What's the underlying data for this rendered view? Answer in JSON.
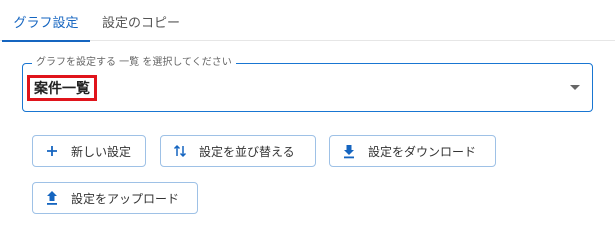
{
  "tabs": [
    {
      "label": "グラフ設定",
      "active": true
    },
    {
      "label": "設定のコピー",
      "active": false
    }
  ],
  "select": {
    "label": "グラフを設定する 一覧 を選択してください",
    "value": "案件一覧"
  },
  "buttons": {
    "new": "新しい設定",
    "sort": "設定を並び替える",
    "download": "設定をダウンロード",
    "upload": "設定をアップロード"
  },
  "colors": {
    "accent": "#1565c0",
    "highlight": "#e0141b"
  },
  "icons": {
    "new": "plus-icon",
    "sort": "swap-vertical-icon",
    "download": "download-icon",
    "upload": "upload-icon",
    "dropdown": "caret-down-icon"
  }
}
